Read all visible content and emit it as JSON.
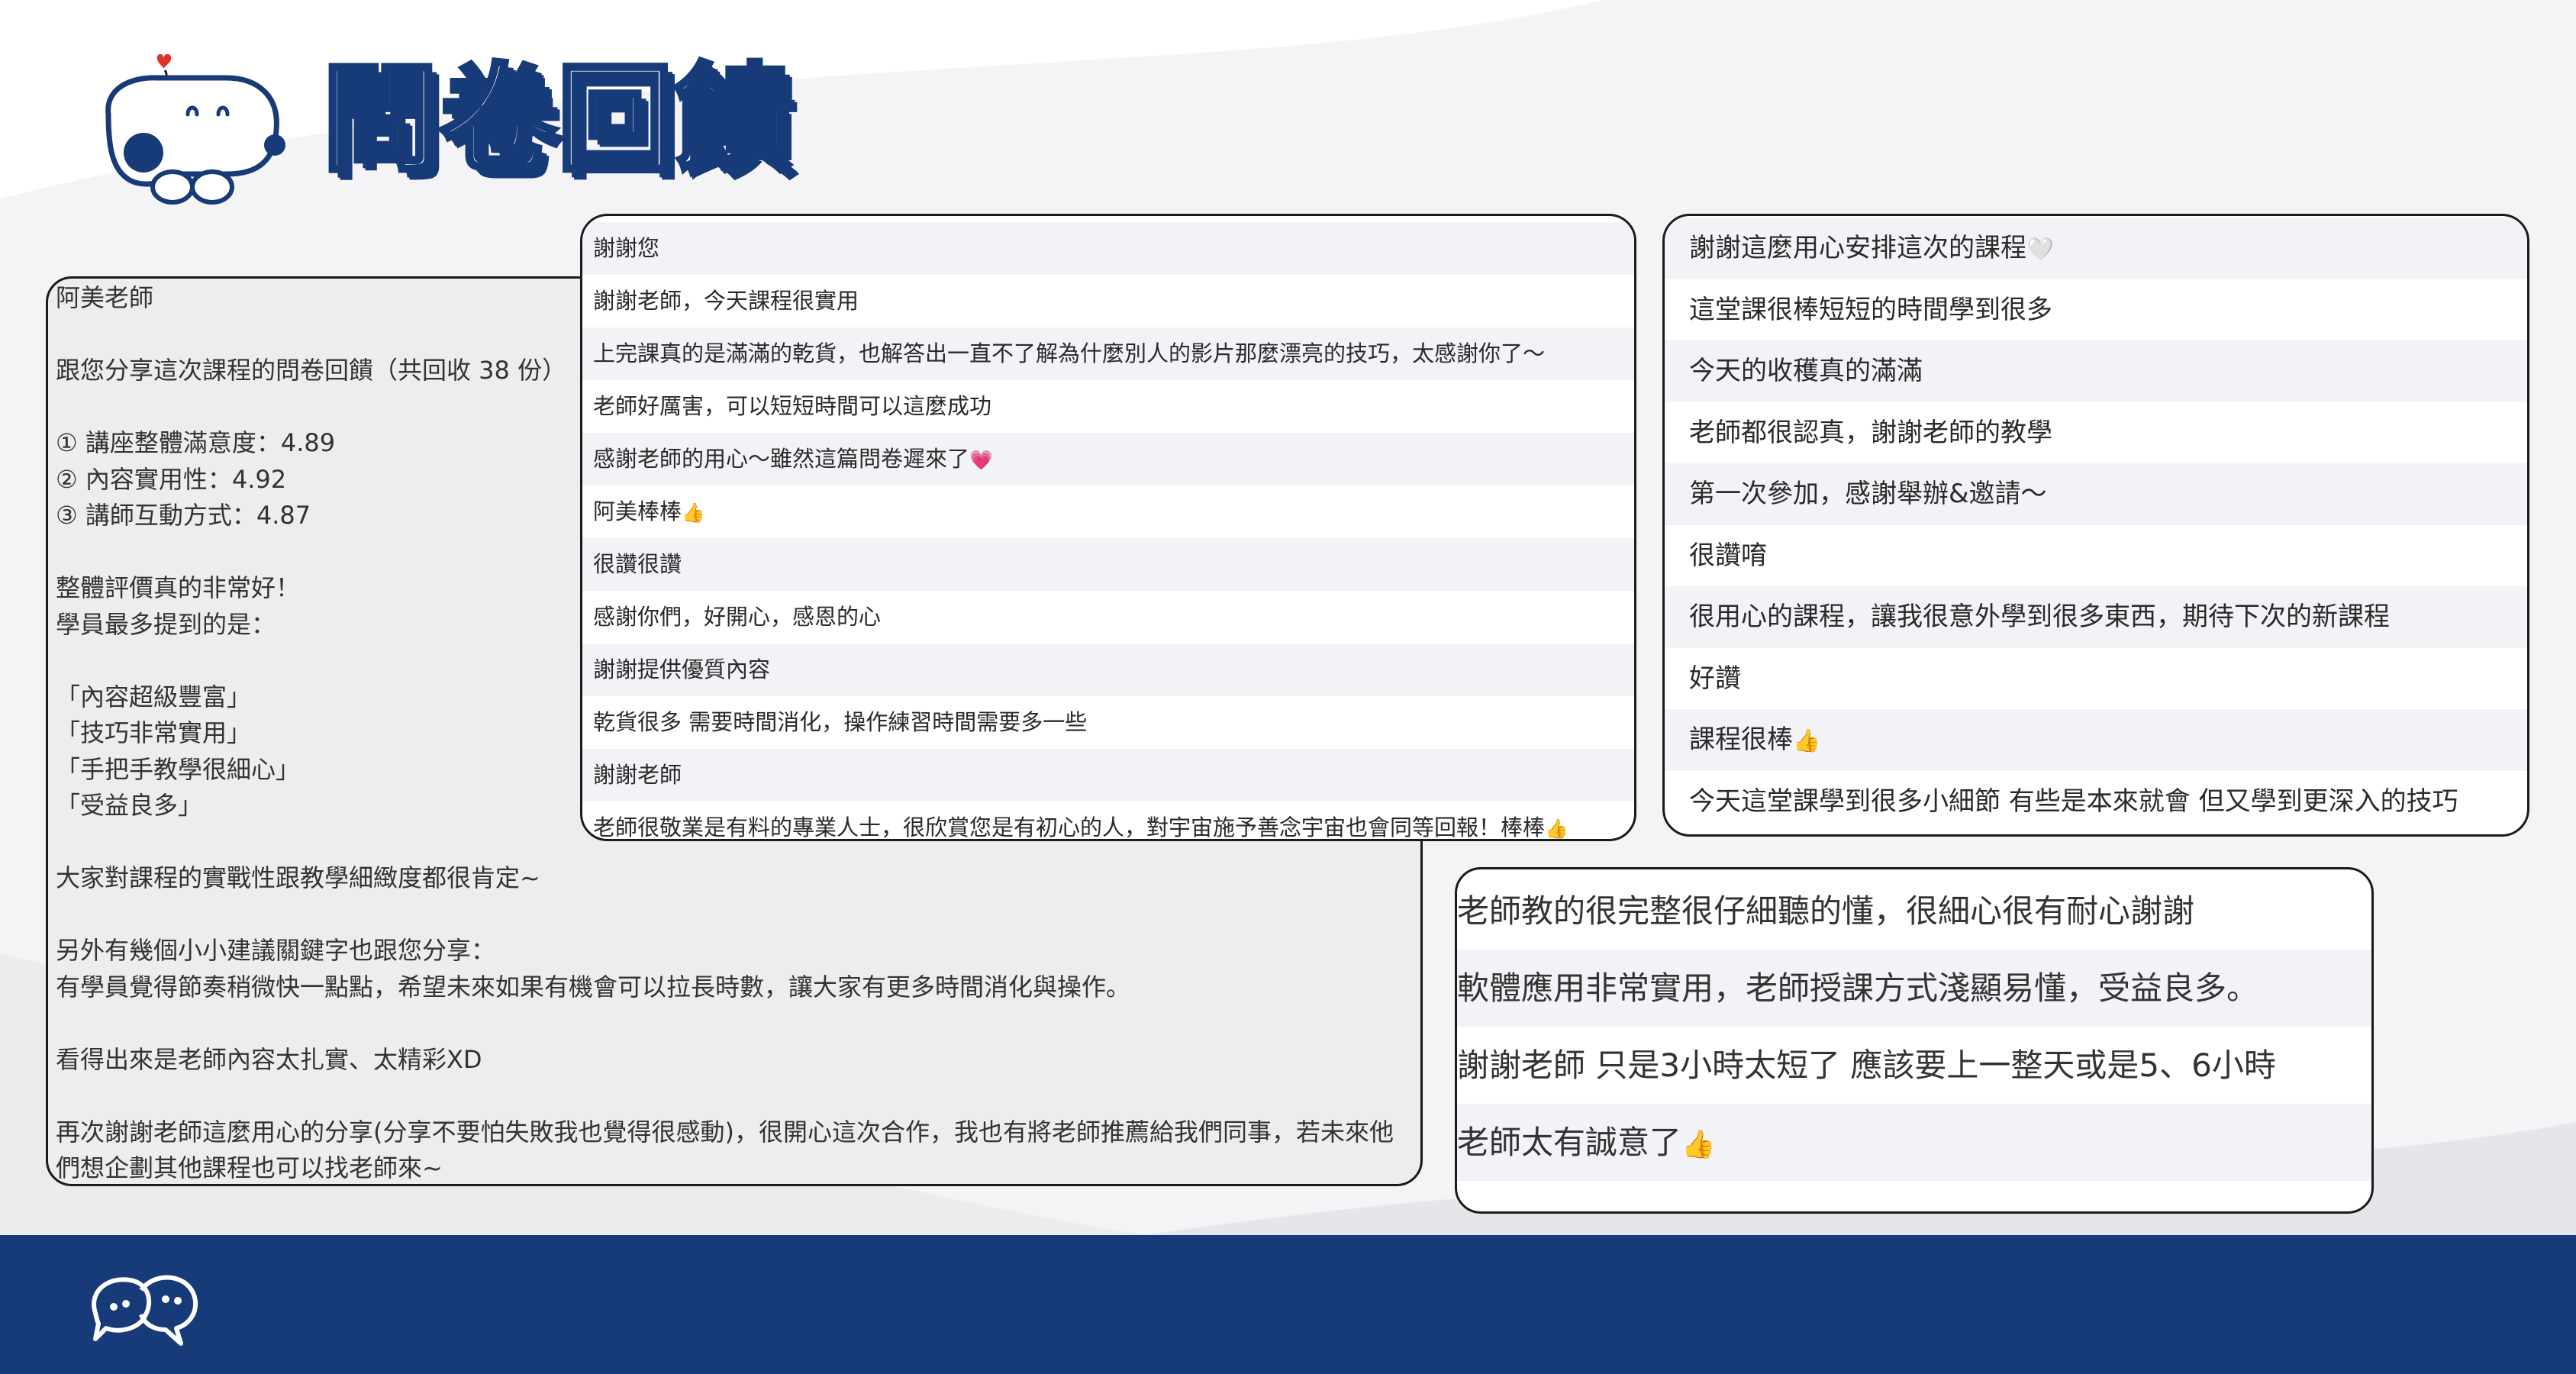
{
  "title": "問卷回饋",
  "colors": {
    "brand_navy": "#173b78",
    "accent_heart": "#e0322b",
    "panel_bg": "#ededed",
    "row_stripe": "#f2f3f7"
  },
  "letter": {
    "lines": [
      "阿美老師",
      "",
      "跟您分享這次課程的問卷回饋（共回收 38 份）",
      "",
      "① 講座整體滿意度：4.89",
      "② 內容實用性：4.92",
      "③ 講師互動方式：4.87",
      "",
      "整體評價真的非常好！",
      "學員最多提到的是：",
      "",
      "「內容超級豐富」",
      "「技巧非常實用」",
      "「手把手教學很細心」",
      "「受益良多」",
      "",
      "大家對課程的實戰性跟教學細緻度都很肯定~",
      "",
      "另外有幾個小小建議關鍵字也跟您分享：",
      "有學員覺得節奏稍微快一點點，希望未來如果有機會可以拉長時數，讓大家有更多時間消化與操作。",
      "",
      "看得出來是老師內容太扎實、太精彩XD",
      ""
    ],
    "closing": "再次謝謝老師這麼用心的分享(分享不要怕失敗我也覺得很感動)，很開心這次合作，我也有將老師推薦給我們同事，若未來他們想企劃其他課程也可以找老師來~"
  },
  "comments_mid": [
    {
      "text": "謝謝您",
      "emoji": ""
    },
    {
      "text": "謝謝老師，今天課程很實用",
      "emoji": ""
    },
    {
      "text": "上完課真的是滿滿的乾貨，也解答出一直不了解為什麼別人的影片那麼漂亮的技巧，太感謝你了～",
      "emoji": ""
    },
    {
      "text": "老師好厲害，可以短短時間可以這麼成功",
      "emoji": ""
    },
    {
      "text": "感謝老師的用心～雖然這篇問卷遲來了",
      "emoji": "💗"
    },
    {
      "text": "阿美棒棒",
      "emoji": "👍"
    },
    {
      "text": "很讚很讚",
      "emoji": ""
    },
    {
      "text": "感謝你們，好開心，感恩的心",
      "emoji": ""
    },
    {
      "text": "謝謝提供優質內容",
      "emoji": ""
    },
    {
      "text": "乾貨很多 需要時間消化，操作練習時間需要多一些",
      "emoji": ""
    },
    {
      "text": "謝謝老師",
      "emoji": ""
    },
    {
      "text": "老師很敬業是有料的專業人士，很欣賞您是有初心的人，對宇宙施予善念宇宙也會同等回報！棒棒",
      "emoji": "👍"
    }
  ],
  "comments_right": [
    {
      "text": "謝謝這麼用心安排這次的課程",
      "emoji": "🤍"
    },
    {
      "text": "這堂課很棒短短的時間學到很多",
      "emoji": ""
    },
    {
      "text": "今天的收穫真的滿滿",
      "emoji": ""
    },
    {
      "text": "老師都很認真，謝謝老師的教學",
      "emoji": ""
    },
    {
      "text": "第一次參加，感謝舉辦&邀請～",
      "emoji": ""
    },
    {
      "text": "很讚唷",
      "emoji": ""
    },
    {
      "text": "很用心的課程，讓我很意外學到很多東西，期待下次的新課程",
      "emoji": ""
    },
    {
      "text": "好讚",
      "emoji": ""
    },
    {
      "text": "課程很棒",
      "emoji": "👍"
    },
    {
      "text": "今天這堂課學到很多小細節 有些是本來就會 但又學到更深入的技巧",
      "emoji": ""
    }
  ],
  "comments_bottom": [
    {
      "text": "老師教的很完整很仔細聽的懂，很細心很有耐心謝謝",
      "emoji": ""
    },
    {
      "text": "軟體應用非常實用，老師授課方式淺顯易懂，受益良多。",
      "emoji": ""
    },
    {
      "text": "謝謝老師 只是3小時太短了 應該要上一整天或是5、6小時",
      "emoji": ""
    },
    {
      "text": "老師太有誠意了",
      "emoji": "👍"
    }
  ]
}
